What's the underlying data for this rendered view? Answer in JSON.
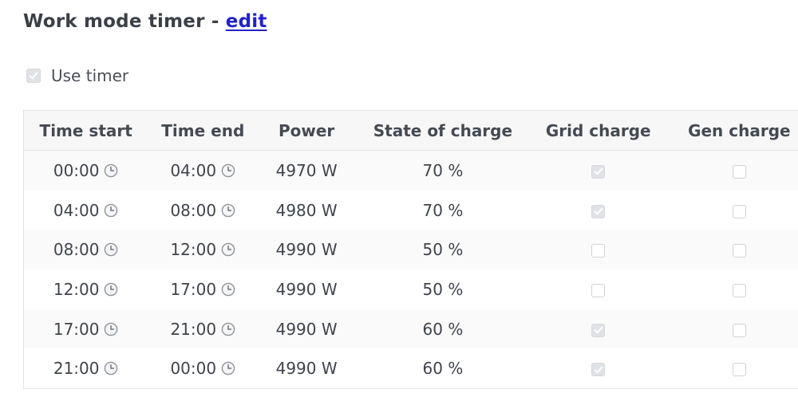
{
  "header": {
    "title_prefix": "Work mode timer - ",
    "edit_label": "edit"
  },
  "use_timer": {
    "label": "Use timer",
    "checked": true
  },
  "table": {
    "columns": [
      "Time start",
      "Time end",
      "Power",
      "State of charge",
      "Grid charge",
      "Gen charge"
    ],
    "rows": [
      {
        "start": "00:00",
        "end": "04:00",
        "power": "4970 W",
        "soc": "70 %",
        "grid_charge": true,
        "gen_charge": false
      },
      {
        "start": "04:00",
        "end": "08:00",
        "power": "4980 W",
        "soc": "70 %",
        "grid_charge": true,
        "gen_charge": false
      },
      {
        "start": "08:00",
        "end": "12:00",
        "power": "4990 W",
        "soc": "50 %",
        "grid_charge": false,
        "gen_charge": false
      },
      {
        "start": "12:00",
        "end": "17:00",
        "power": "4990 W",
        "soc": "50 %",
        "grid_charge": false,
        "gen_charge": false
      },
      {
        "start": "17:00",
        "end": "21:00",
        "power": "4990 W",
        "soc": "60 %",
        "grid_charge": true,
        "gen_charge": false
      },
      {
        "start": "21:00",
        "end": "00:00",
        "power": "4990 W",
        "soc": "60 %",
        "grid_charge": true,
        "gen_charge": false
      }
    ]
  },
  "icons": {
    "clock": "clock-icon",
    "checkmark": "checkmark-icon"
  },
  "colors": {
    "link": "#2323c8",
    "text": "#3b4048",
    "header_bg": "#f7f7f8",
    "checkbox_checked_bg": "#dfe2e6"
  }
}
